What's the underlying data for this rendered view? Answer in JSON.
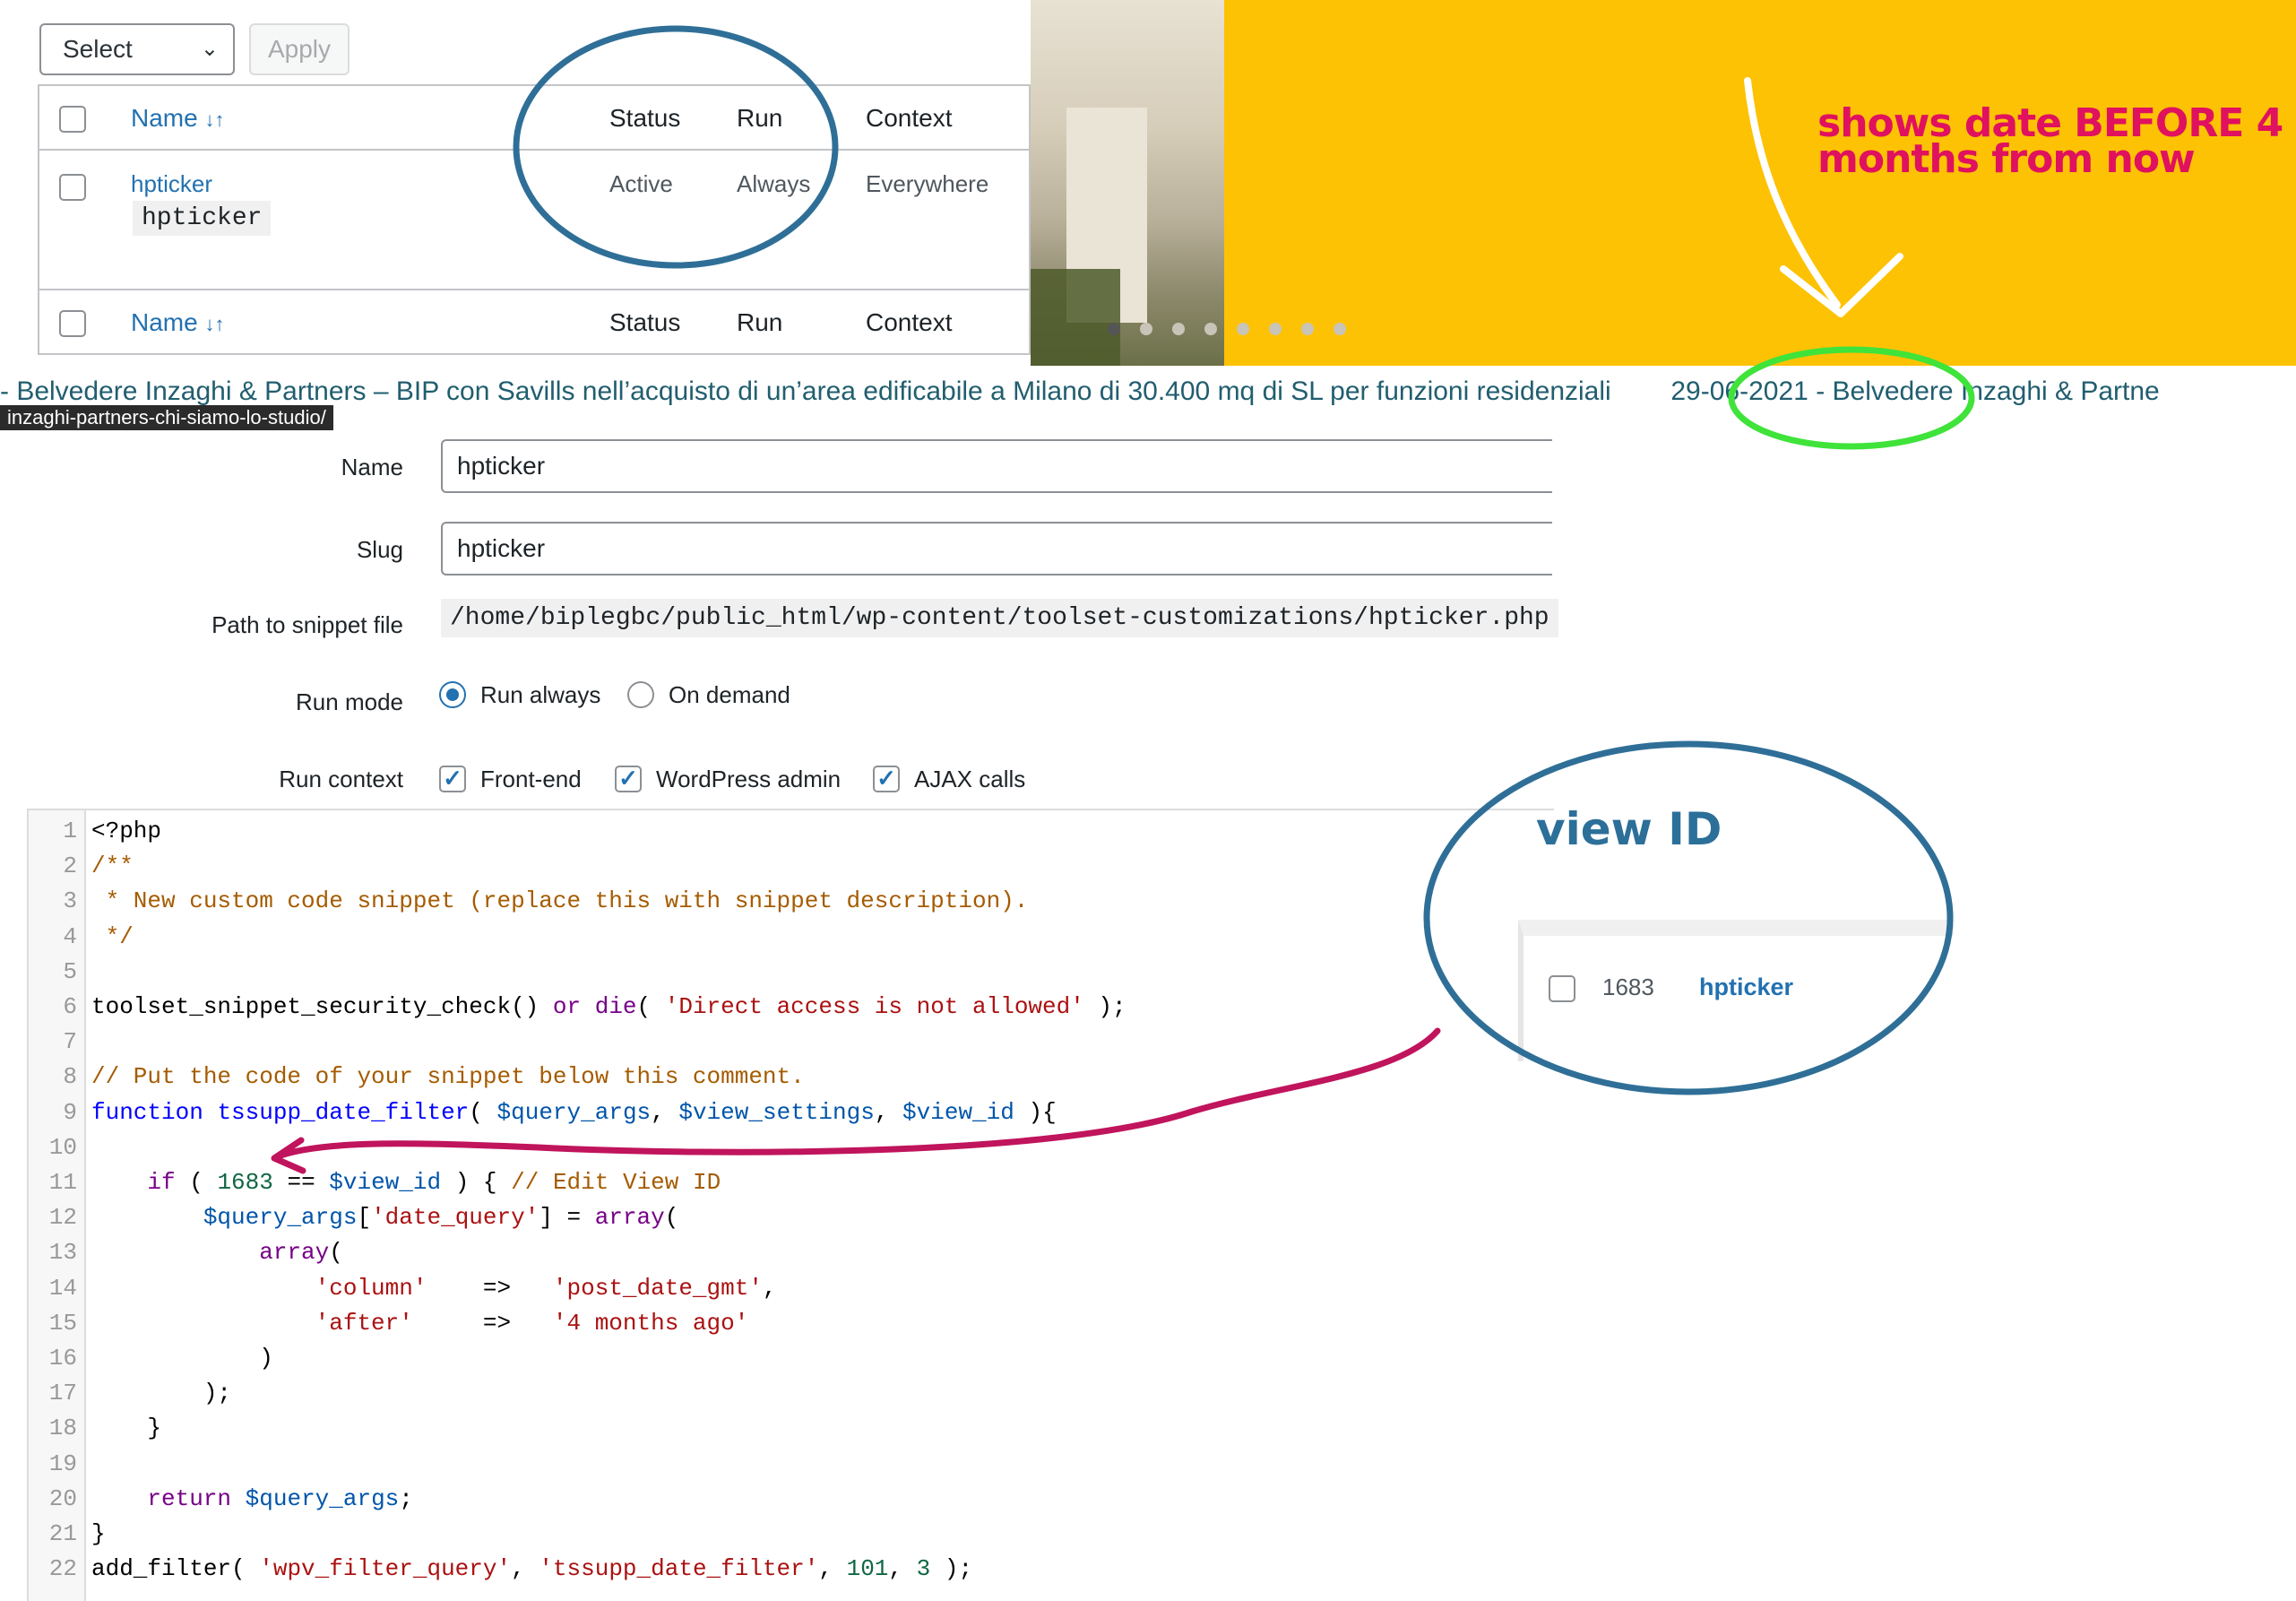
{
  "bulk_actions": {
    "select_label": "Select",
    "apply_label": "Apply"
  },
  "snippets_table": {
    "header": {
      "name": "Name",
      "status": "Status",
      "run": "Run",
      "context": "Context"
    },
    "rows": [
      {
        "name": "hpticker",
        "slug": "hpticker",
        "status": "Active",
        "run": "Always",
        "context": "Everywhere"
      }
    ]
  },
  "banner": {
    "annotation": "shows date BEFORE 4 months from now",
    "annotation_color": "#e0115f",
    "background": "#fdc204"
  },
  "ticker": {
    "text_before": "- Belvedere Inzaghi & Partners – BIP con Savills nell’acquisto di un’area edificabile a Milano di 30.400 mq di SL per funzioni residenziali",
    "date": "29-06-2021",
    "text_after": "- Belvedere Inzaghi & Partne"
  },
  "link_tooltip": "inzaghi-partners-chi-siamo-lo-studio/",
  "form": {
    "name_label": "Name",
    "name_value": "hpticker",
    "slug_label": "Slug",
    "slug_value": "hpticker",
    "path_label": "Path to snippet file",
    "path_value": "/home/biplegbc/public_html/wp-content/toolset-customizations/hpticker.php",
    "run_mode_label": "Run mode",
    "run_mode_always": "Run always",
    "run_mode_demand": "On demand",
    "run_context_label": "Run context",
    "ctx_frontend": "Front-end",
    "ctx_admin": "WordPress admin",
    "ctx_ajax": "AJAX calls"
  },
  "code_lines": [
    "<?php",
    "/**",
    " * New custom code snippet (replace this with snippet description).",
    " */",
    "",
    "toolset_snippet_security_check() or die( 'Direct access is not allowed' );",
    "",
    "// Put the code of your snippet below this comment.",
    "function tssupp_date_filter( $query_args, $view_settings, $view_id ){",
    "",
    "    if ( 1683 == $view_id ) { // Edit View ID",
    "        $query_args['date_query'] = array(",
    "            array(",
    "                'column'    =>   'post_date_gmt',",
    "                'after'     =>   '4 months ago'",
    "            )",
    "        );",
    "    }",
    "",
    "    return $query_args;",
    "}",
    "add_filter( 'wpv_filter_query', 'tssupp_date_filter', 101, 3 );"
  ],
  "view_popup": {
    "title": "view ID",
    "id": "1683",
    "name": "hpticker"
  },
  "colors": {
    "circle_blue": "#2f6f97",
    "circle_green": "#3fe33a",
    "arrow_magenta": "#c0145c",
    "wp_link": "#2271b1"
  }
}
